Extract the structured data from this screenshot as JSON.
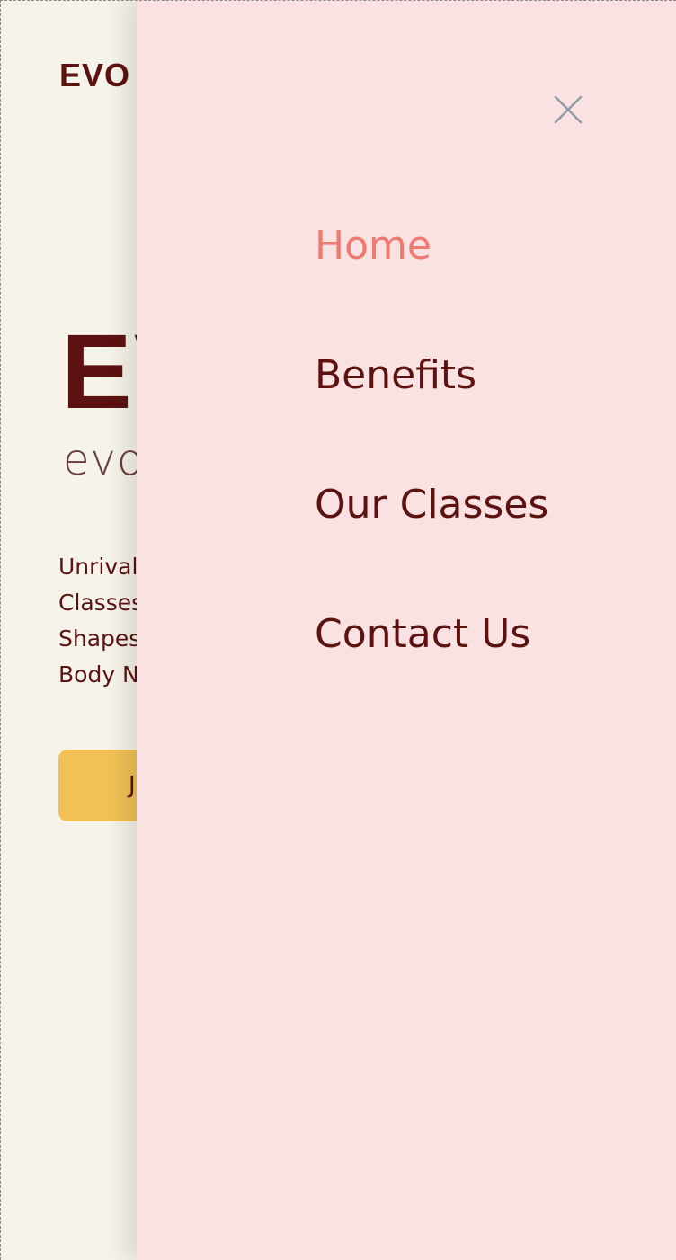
{
  "page": {
    "logo": "EVO",
    "hero_title": "EV",
    "hero_subtitle": "evo",
    "hero_text_lines": [
      "Unrival",
      "Classes",
      "Shapes",
      "Body N"
    ],
    "cta_label": "J"
  },
  "drawer": {
    "close_icon": "close-icon",
    "menu": [
      {
        "label": "Home",
        "active": true
      },
      {
        "label": "Benefits",
        "active": false
      },
      {
        "label": "Our Classes",
        "active": false
      },
      {
        "label": "Contact Us",
        "active": false
      }
    ]
  },
  "colors": {
    "background": "#f6f3ea",
    "drawer_background": "#f9e2e1",
    "brand_maroon": "#5c1210",
    "active_link": "#ef7a72",
    "button_yellow": "#f2c155",
    "close_icon": "#8e9aa6"
  }
}
